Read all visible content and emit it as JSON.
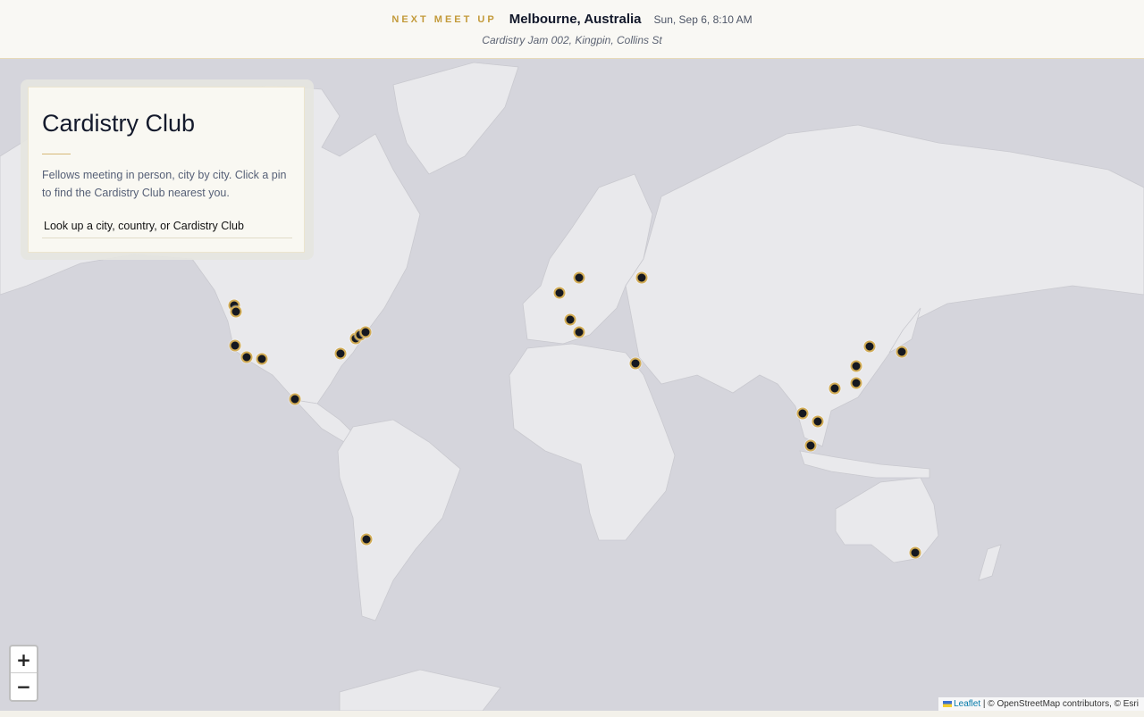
{
  "banner": {
    "eyebrow": "NEXT MEET UP",
    "city": "Melbourne, Australia",
    "datetime": "Sun, Sep 6, 8:10 AM",
    "venue": "Cardistry Jam 002, Kingpin, Collins St"
  },
  "panel": {
    "title": "Cardistry Club",
    "description": "Fellows meeting in person, city by city. Click a pin to find the Cardistry Club nearest you.",
    "search_placeholder": "Look up a city, country, or Cardistry Club"
  },
  "map": {
    "zoom_in": "+",
    "zoom_out": "−",
    "attribution": {
      "leaflet": "Leaflet",
      "separator": "|",
      "credits": "© OpenStreetMap contributors, © Esri"
    },
    "colors": {
      "water": "#d5d5dc",
      "land": "#e9e9ec",
      "pin_fill": "#151820",
      "pin_ring": "#d2ac55",
      "accent": "#c39a3a"
    }
  }
}
